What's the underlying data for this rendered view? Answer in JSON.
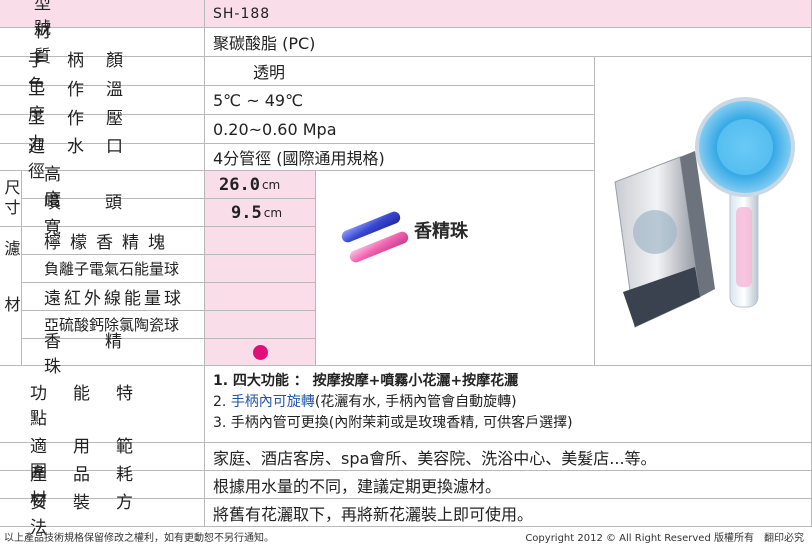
{
  "specs": {
    "model": {
      "label": "型號",
      "value": "SH-188"
    },
    "material": {
      "label": "材質",
      "value": "聚碳酸脂 (PC)"
    },
    "handle_color": {
      "label": "手柄顏色",
      "value": "透明"
    },
    "work_temp": {
      "label": "工作溫度",
      "value": "5℃ ~ 49℃"
    },
    "work_pressure": {
      "label": "工作壓力",
      "value": "0.20~0.60 Mpa"
    },
    "inlet_diameter": {
      "label": "進水口徑",
      "value": "4分管徑 (國際通用規格)"
    }
  },
  "size": {
    "group_label": "尺寸",
    "height": {
      "label": "高度",
      "value": "26.0",
      "unit": "cm"
    },
    "head_width": {
      "label": "噴頭寬",
      "value": "9.5",
      "unit": "cm"
    }
  },
  "filter": {
    "group_label": "濾材",
    "items": [
      "檸檬香精塊",
      "負離子電氣石能量球",
      "遠紅外線能量球",
      "亞硫酸鈣除氯陶瓷球",
      "香精珠"
    ],
    "bead_label": "香精珠",
    "dot_color": "#e0107a"
  },
  "features": {
    "label": "功能特點",
    "line1": "1. 四大功能 ： 按摩按摩+噴霧小花灑+按摩花灑",
    "line2_num": "2. ",
    "line2_highlight": "手柄內可旋轉",
    "line2_rest": "(花灑有水, 手柄內管會自動旋轉)",
    "line3": "3. 手柄內管可更換(內附茉莉或是玫瑰香精, 可供客戶選擇)",
    "highlight_color": "#2255aa"
  },
  "scope": {
    "label": "適用範圍",
    "value": "家庭、酒店客房、spa會所、美容院、洗浴中心、美髮店...等。"
  },
  "consumables": {
    "label": "產品耗材",
    "value": "根據用水量的不同，建議定期更換濾材。"
  },
  "install": {
    "label": "安裝方法",
    "value": "將舊有花灑取下，再將新花灑裝上即可使用。"
  },
  "footer": {
    "note": "以上產品技術規格保留修改之權利，如有更動恕不另行通知。",
    "copyright": "Copyright 2012 © All Right Reserved 版權所有　翻印必究"
  },
  "colors": {
    "pink": "#f9dde8",
    "border": "#b9b9b9",
    "beads": [
      "#4a58d8",
      "#f06ab0"
    ]
  }
}
